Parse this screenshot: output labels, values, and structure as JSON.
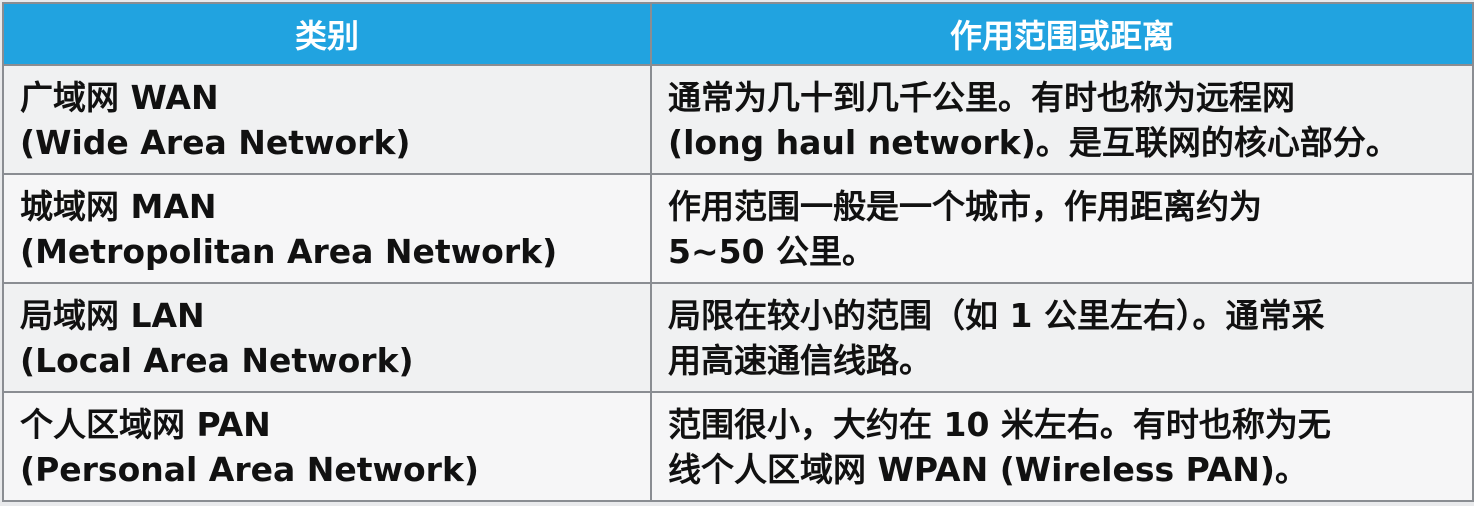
{
  "header": {
    "category": "类别",
    "range": "作用范围或距离"
  },
  "rows": [
    {
      "name": "广域网 WAN",
      "full": "(Wide Area Network)",
      "desc_line1": "通常为几十到几千公里。有时也称为远程网",
      "desc_line2": "(long haul network)。是互联网的核心部分。"
    },
    {
      "name": "城域网 MAN",
      "full": "(Metropolitan Area Network)",
      "desc_line1": "作用范围一般是一个城市，作用距离约为",
      "desc_line2": "5~50 公里。"
    },
    {
      "name": "局域网 LAN",
      "full": "(Local Area Network)",
      "desc_line1": "局限在较小的范围（如 1 公里左右）。通常采",
      "desc_line2": "用高速通信线路。"
    },
    {
      "name": "个人区域网 PAN",
      "full": "(Personal Area Network)",
      "desc_line1": "范围很小，大约在 10 米左右。有时也称为无",
      "desc_line2": "线个人区域网 WPAN (Wireless PAN)。"
    }
  ],
  "colors": {
    "header_bg": "#21a3e0",
    "header_text": "#ffffff",
    "border": "#8a8d92"
  }
}
